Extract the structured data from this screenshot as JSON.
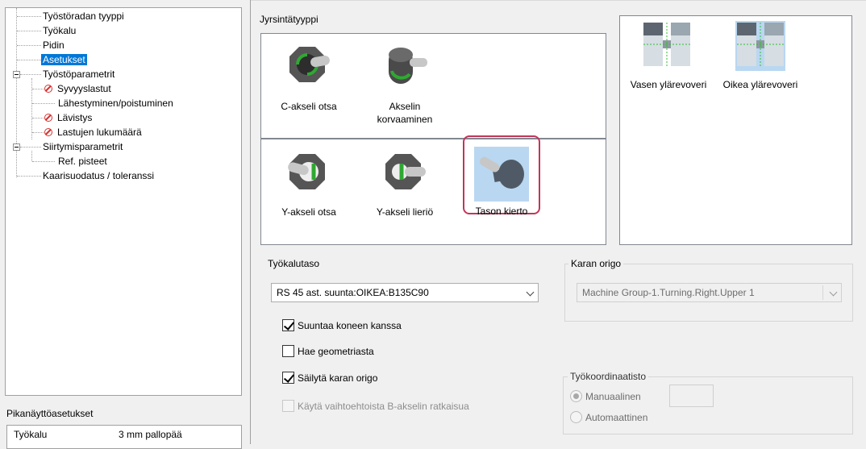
{
  "tree": {
    "items": [
      {
        "label": "Työstöradan tyyppi"
      },
      {
        "label": "Työkalu"
      },
      {
        "label": "Pidin"
      },
      {
        "label": "Asetukset"
      },
      {
        "label": "Työstöparametrit"
      },
      {
        "label": "Syvyyslastut"
      },
      {
        "label": "Lähestyminen/poistuminen"
      },
      {
        "label": "Lävistys"
      },
      {
        "label": "Lastujen lukumäärä"
      },
      {
        "label": "Siirtymisparametrit"
      },
      {
        "label": "Ref. pisteet"
      },
      {
        "label": "Kaarisuodatus / toleranssi"
      }
    ],
    "selected": "Asetukset"
  },
  "quickview": {
    "title": "Pikanäyttöasetukset",
    "rows": [
      {
        "key": "Työkalu",
        "value": "3 mm pallopää"
      }
    ]
  },
  "milling": {
    "label": "Jyrsintätyyppi",
    "row1": [
      {
        "label": "C-akseli otsa",
        "icon": "c-axis-face-icon"
      },
      {
        "label": "Akselin\nkorvaaminen",
        "icon": "axis-substitution-icon"
      }
    ],
    "row2": [
      {
        "label": "Y-akseli otsa",
        "icon": "y-axis-face-icon"
      },
      {
        "label": "Y-akseli lieriö",
        "icon": "y-axis-cylinder-icon"
      },
      {
        "label": "Tason kierto",
        "icon": "plane-rotation-icon",
        "selected": true
      }
    ],
    "turret": [
      {
        "label": "Vasen ylärevoveri",
        "icon": "left-upper-turret-icon"
      },
      {
        "label": "Oikea ylärevoveri",
        "icon": "right-upper-turret-icon",
        "selected": true
      }
    ]
  },
  "toolplane": {
    "label": "Työkalutaso",
    "value": "RS 45 ast. suunta:OIKEA:B135C90",
    "checks": [
      {
        "label": "Suuntaa koneen kanssa",
        "checked": true,
        "enabled": true
      },
      {
        "label": "Hae geometriasta",
        "checked": false,
        "enabled": true
      },
      {
        "label": "Säilytä karan origo",
        "checked": true,
        "enabled": true
      },
      {
        "label": "Käytä vaihtoehtoista B-akselin ratkaisua",
        "checked": false,
        "enabled": false
      }
    ]
  },
  "spindle": {
    "label": "Karan origo",
    "value": "Machine Group-1.Turning.Right.Upper 1"
  },
  "wcs": {
    "label": "Työkoordinaatisto",
    "options": [
      {
        "label": "Manuaalinen",
        "selected": true
      },
      {
        "label": "Automaattinen",
        "selected": false
      }
    ]
  },
  "colors": {
    "selection": "#0078d7",
    "tile_highlight": "#c0365a",
    "error": "#d43030"
  }
}
